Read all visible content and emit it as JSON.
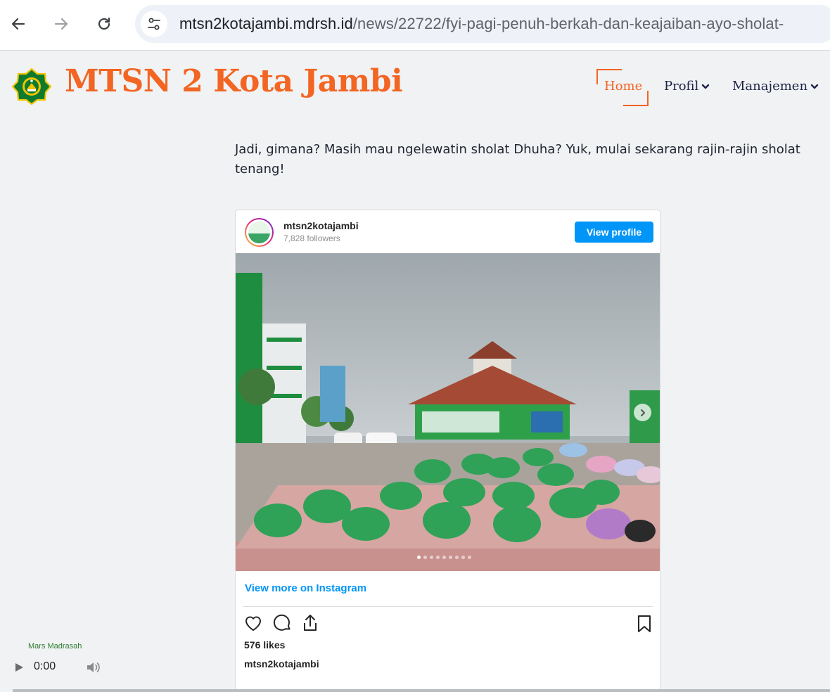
{
  "browser": {
    "url_host": "mtsn2kotajambi.mdrsh.id",
    "url_path": "/news/22722/fyi-pagi-penuh-berkah-dan-keajaiban-ayo-sholat-",
    "icons": [
      "back-arrow-icon",
      "forward-arrow-icon",
      "reload-icon",
      "site-settings-icon"
    ]
  },
  "site": {
    "title": "MTSN 2 Kota Jambi",
    "accent_color": "#f26522",
    "nav": {
      "home": "Home",
      "profil": "Profil",
      "manajemen": "Manajemen"
    }
  },
  "article": {
    "line1": "Jadi, gimana? Masih mau ngelewatin sholat Dhuha? Yuk, mulai sekarang rajin-rajin sholat",
    "line2": "tenang!"
  },
  "instagram": {
    "username": "mtsn2kotajambi",
    "followers": "7,828 followers",
    "view_profile": "View profile",
    "view_more": "View more on Instagram",
    "likes": "576 likes",
    "caption_user": "mtsn2kotajambi",
    "carousel_slide": 1,
    "carousel_total": 9,
    "button_color": "#0095f6"
  },
  "audio": {
    "title": "Mars Madrasah",
    "time": "0:00"
  }
}
